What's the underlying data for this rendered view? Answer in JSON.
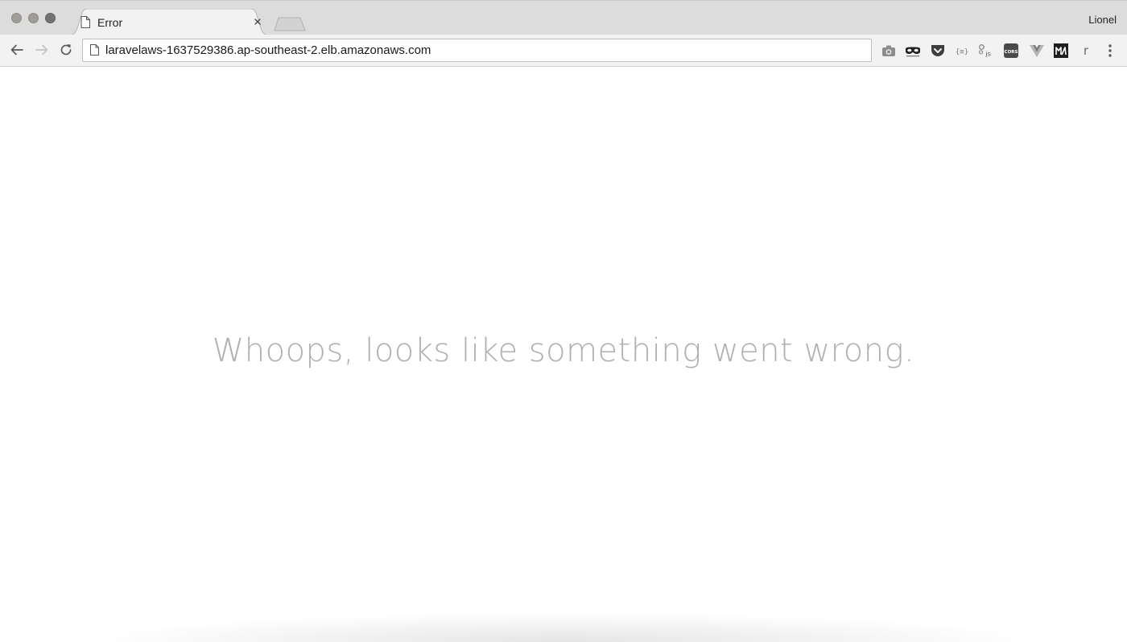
{
  "window": {
    "profile_name": "Lionel"
  },
  "tab": {
    "title": "Error",
    "favicon": "document-icon"
  },
  "toolbar": {
    "url": "laravelaws-1637529386.ap-southeast-2.elb.amazonaws.com",
    "extensions": [
      "camera-icon",
      "mask-icon",
      "pocket-icon",
      "json-formatter-icon",
      "javascript-icon",
      "cors-icon",
      "vue-devtools-icon",
      "markdown-icon",
      "r-icon",
      "menu-icon"
    ]
  },
  "page": {
    "message": "Whoops, looks like something went wrong."
  },
  "colors": {
    "tabstrip": "#dcdcdc",
    "toolbar": "#f2f2f2",
    "message_text": "#b0b0b0"
  }
}
